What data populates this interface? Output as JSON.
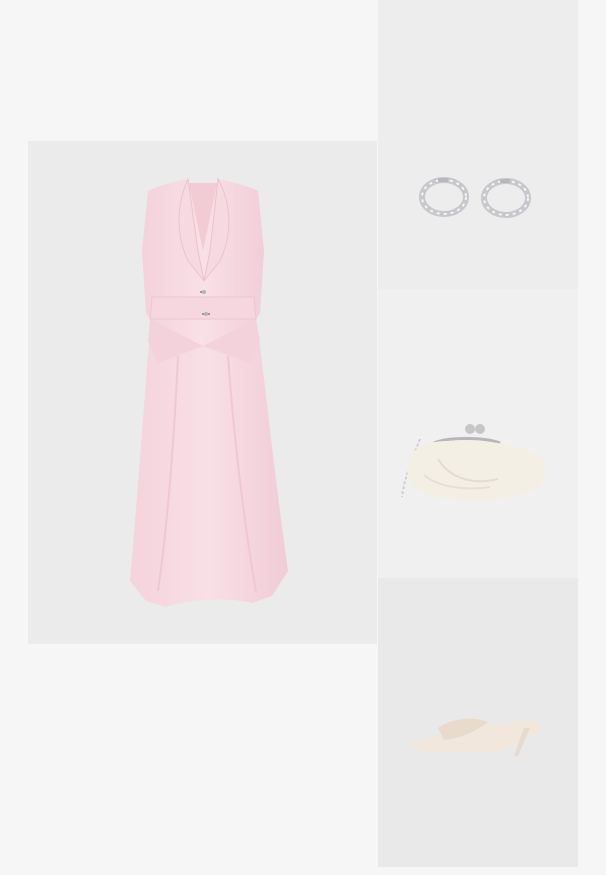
{
  "outfit": {
    "items": [
      {
        "id": "dress",
        "icon": "pink-vest-dress-image",
        "color": "#f8dbe2"
      },
      {
        "id": "earrings",
        "icon": "silver-hoop-earrings-image",
        "color": "#d9d9db"
      },
      {
        "id": "bag",
        "icon": "cream-pouch-clutch-image",
        "color": "#f3efe4"
      },
      {
        "id": "shoes",
        "icon": "cream-kitten-heel-mule-image",
        "color": "#f1e7dc"
      }
    ]
  },
  "colors": {
    "page_background": "#f6f6f6",
    "card_background": "#ebebeb"
  }
}
